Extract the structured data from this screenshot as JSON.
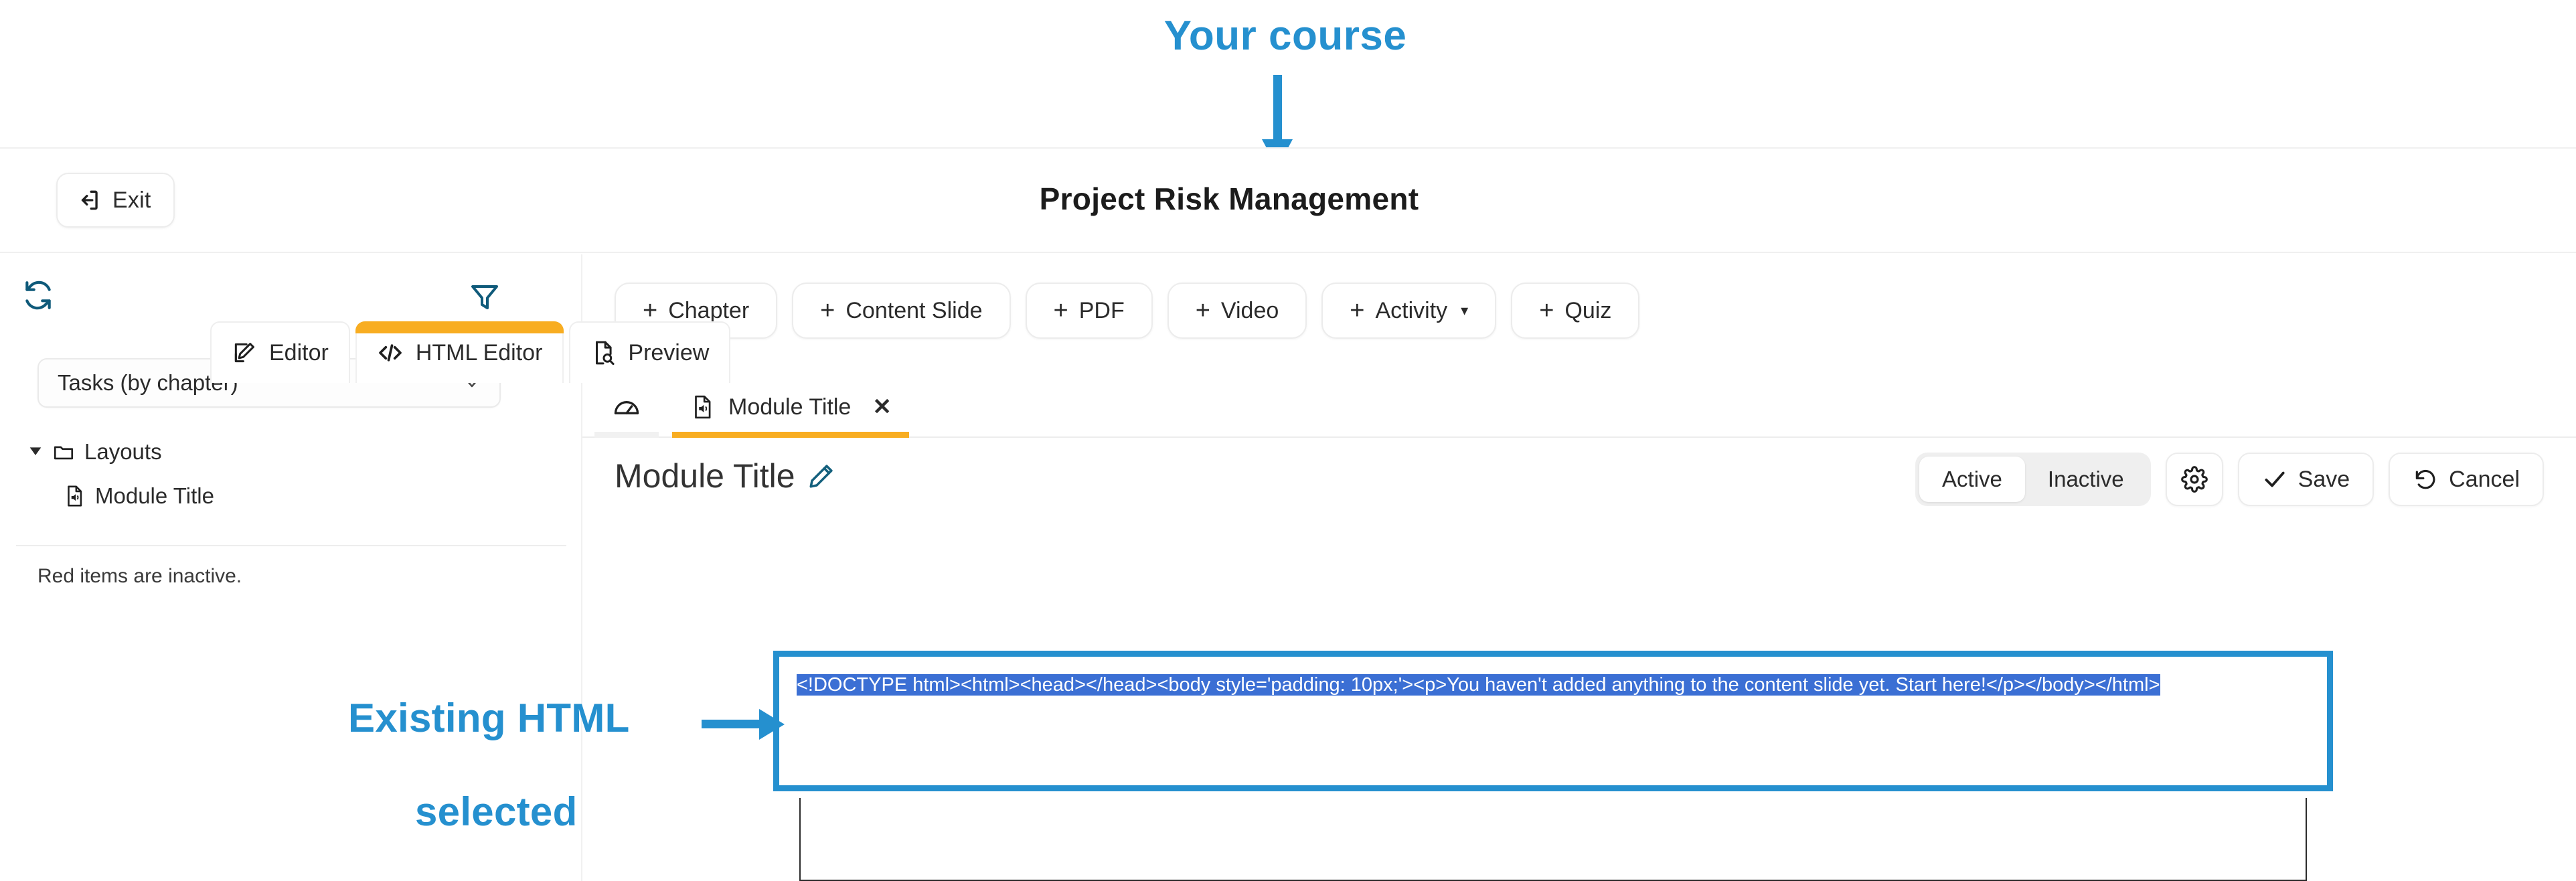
{
  "annotations": {
    "color": "#2590cf",
    "course_label": "Your course",
    "html_label_line1": "Existing HTML",
    "html_label_line2": "selected"
  },
  "header": {
    "exit_label": "Exit",
    "course_title": "Project Risk Management"
  },
  "sidebar": {
    "filter_select_value": "Tasks (by chapter)",
    "tree": [
      {
        "label": "Layouts",
        "icon": "folder-icon",
        "level": 0,
        "expanded": true
      },
      {
        "label": "Module Title",
        "icon": "slide-audio-icon",
        "level": 1,
        "expanded": false
      }
    ],
    "note": "Red items are inactive."
  },
  "toolbar": {
    "buttons": [
      {
        "label": "Chapter",
        "has_caret": false
      },
      {
        "label": "Content Slide",
        "has_caret": false
      },
      {
        "label": "PDF",
        "has_caret": false
      },
      {
        "label": "Video",
        "has_caret": false
      },
      {
        "label": "Activity",
        "has_caret": true
      },
      {
        "label": "Quiz",
        "has_caret": false
      }
    ],
    "plus": "+",
    "caret": "▾"
  },
  "tabs": {
    "dashboard_label": "",
    "module_label": "Module Title",
    "close_glyph": "✕",
    "active_color": "#f8ad21"
  },
  "title_row": {
    "title": "Module Title",
    "toggle": {
      "active_label": "Active",
      "inactive_label": "Inactive",
      "selected": "Active"
    },
    "save_label": "Save",
    "cancel_label": "Cancel"
  },
  "editor_tabs": [
    {
      "label": "Editor",
      "icon": "edit-square-icon",
      "active": false
    },
    {
      "label": "HTML Editor",
      "icon": "code-brackets-icon",
      "active": true
    },
    {
      "label": "Preview",
      "icon": "page-search-icon",
      "active": false
    }
  ],
  "code_editor": {
    "selected_text": "<!DOCTYPE html><html><head></head><body style='padding: 10px;'><p>You haven't added anything to the content slide yet. Start here!</p></body></html>",
    "selection_color": "#3b6fd4"
  }
}
